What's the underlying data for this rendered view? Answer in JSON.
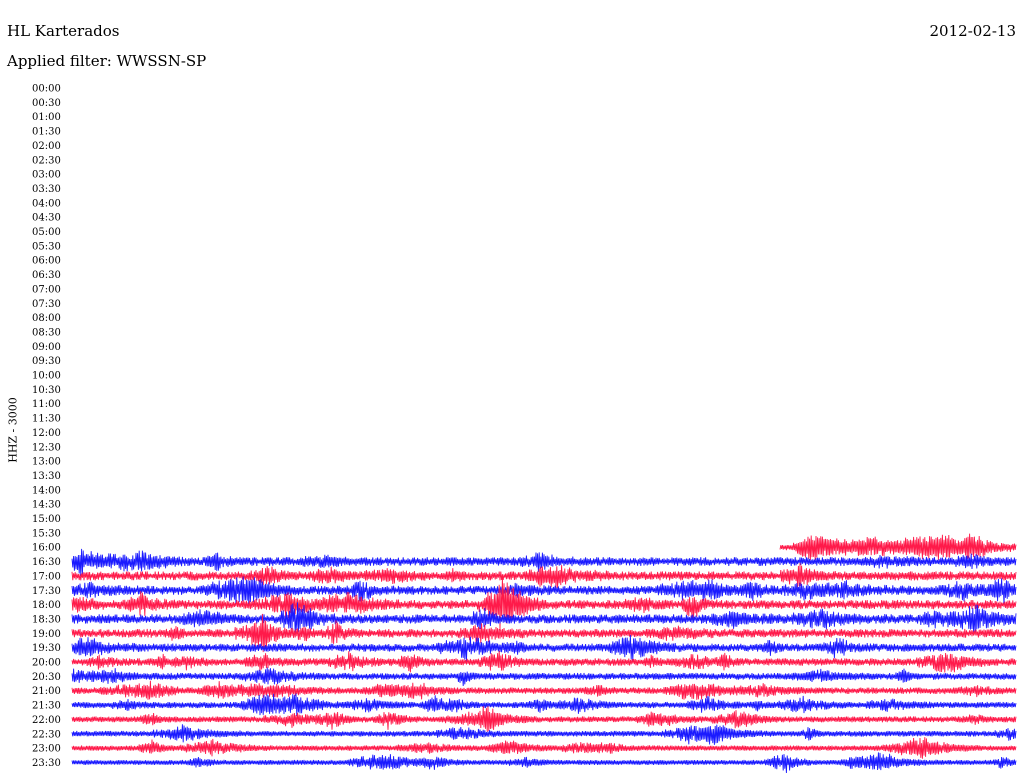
{
  "header": {
    "station": "HL Karterados",
    "date": "2012-02-13",
    "filter": "Applied filter: WWSSN-SP"
  },
  "chart_data": {
    "type": "line",
    "title": "HL Karterados",
    "subtitle": "Applied filter: WWSSN-SP",
    "ylabel": "HHZ - 3000",
    "xlabel": "",
    "y_tick_labels": [
      "00:00",
      "00:30",
      "01:00",
      "01:30",
      "02:00",
      "02:30",
      "03:00",
      "03:30",
      "04:00",
      "04:30",
      "05:00",
      "05:30",
      "06:00",
      "06:30",
      "07:00",
      "07:30",
      "08:00",
      "08:30",
      "09:00",
      "09:30",
      "10:00",
      "10:30",
      "11:00",
      "11:30",
      "12:00",
      "12:30",
      "13:00",
      "13:30",
      "14:00",
      "14:30",
      "15:00",
      "15:30",
      "16:00",
      "16:30",
      "17:00",
      "17:30",
      "18:00",
      "18:30",
      "19:00",
      "19:30",
      "20:00",
      "20:30",
      "21:00",
      "21:30",
      "22:00",
      "22:30",
      "23:00",
      "23:30"
    ],
    "trace_colors": [
      "#ff1a4a",
      "#1a1aff"
    ],
    "first_data_row": "16:00",
    "row_16_00_partial_start_fraction": 0.75,
    "noise_level_by_row": {
      "16:00": 0.5,
      "16:30": 0.9,
      "17:00": 0.95,
      "17:30": 0.95,
      "18:00": 1.0,
      "18:30": 1.0,
      "19:00": 0.9,
      "19:30": 0.8,
      "20:00": 0.7,
      "20:30": 0.6,
      "21:00": 0.55,
      "21:30": 0.5,
      "22:00": 0.45,
      "22:30": 0.4,
      "23:00": 0.35,
      "23:30": 0.3
    },
    "grid": false
  }
}
